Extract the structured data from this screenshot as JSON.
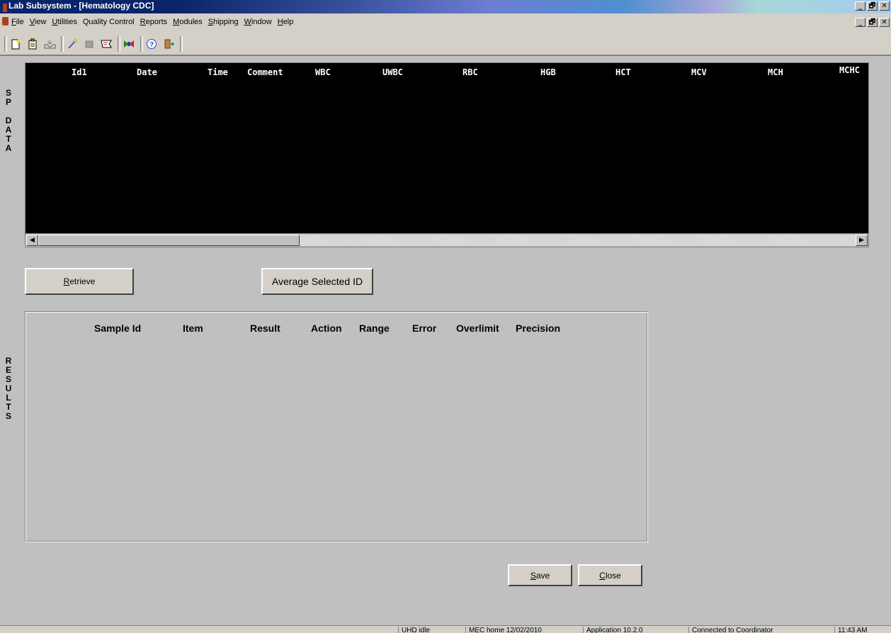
{
  "window": {
    "title": "Lab Subsystem - [Hematology CDC]"
  },
  "window_controls": {
    "minimize": "_",
    "restore": "🗗",
    "close": "✕"
  },
  "menu": [
    {
      "label": "File",
      "accel": "F"
    },
    {
      "label": "View",
      "accel": "V"
    },
    {
      "label": "Utilities",
      "accel": "U"
    },
    {
      "label": "Quality Control",
      "accel": ""
    },
    {
      "label": "Reports",
      "accel": "R"
    },
    {
      "label": "Modules",
      "accel": "M"
    },
    {
      "label": "Shipping",
      "accel": "S"
    },
    {
      "label": "Window",
      "accel": "W"
    },
    {
      "label": "Help",
      "accel": "H"
    }
  ],
  "toolbar": {
    "icons": [
      "new-document-icon",
      "clipboard-icon",
      "tray-icon",
      "magic-wand-icon",
      "square-icon",
      "flag-icon",
      "chart-icon",
      "help-icon",
      "exit-door-icon"
    ]
  },
  "sp_data": {
    "side_label": "S\nP\n\nD\nA\nT\nA",
    "columns": [
      "Id1",
      "Date",
      "Time",
      "Comment",
      "WBC",
      "UWBC",
      "RBC",
      "HGB",
      "HCT",
      "MCV",
      "MCH",
      "MCHC"
    ],
    "rows": []
  },
  "buttons": {
    "retrieve": "Retrieve",
    "retrieve_accel": "R",
    "average": "Average Selected ID",
    "save": "Save",
    "save_accel": "S",
    "close": "Close",
    "close_accel": "C"
  },
  "results": {
    "side_label": "R\nE\nS\nU\nL\nT\nS",
    "columns": [
      "Sample Id",
      "Item",
      "Result",
      "Action",
      "Range",
      "Error",
      "Overlimit",
      "Precision"
    ],
    "rows": []
  },
  "statusbar": {
    "panes": [
      "",
      "UHD idle",
      "MEC home 12/02/2010",
      "Application 10.2.0",
      "Connected to Coordinator",
      "11:43 AM"
    ]
  },
  "colors": {
    "title_bar": "#0a246a",
    "grid_bg": "#000000",
    "window_bg": "#c0c0c0"
  }
}
